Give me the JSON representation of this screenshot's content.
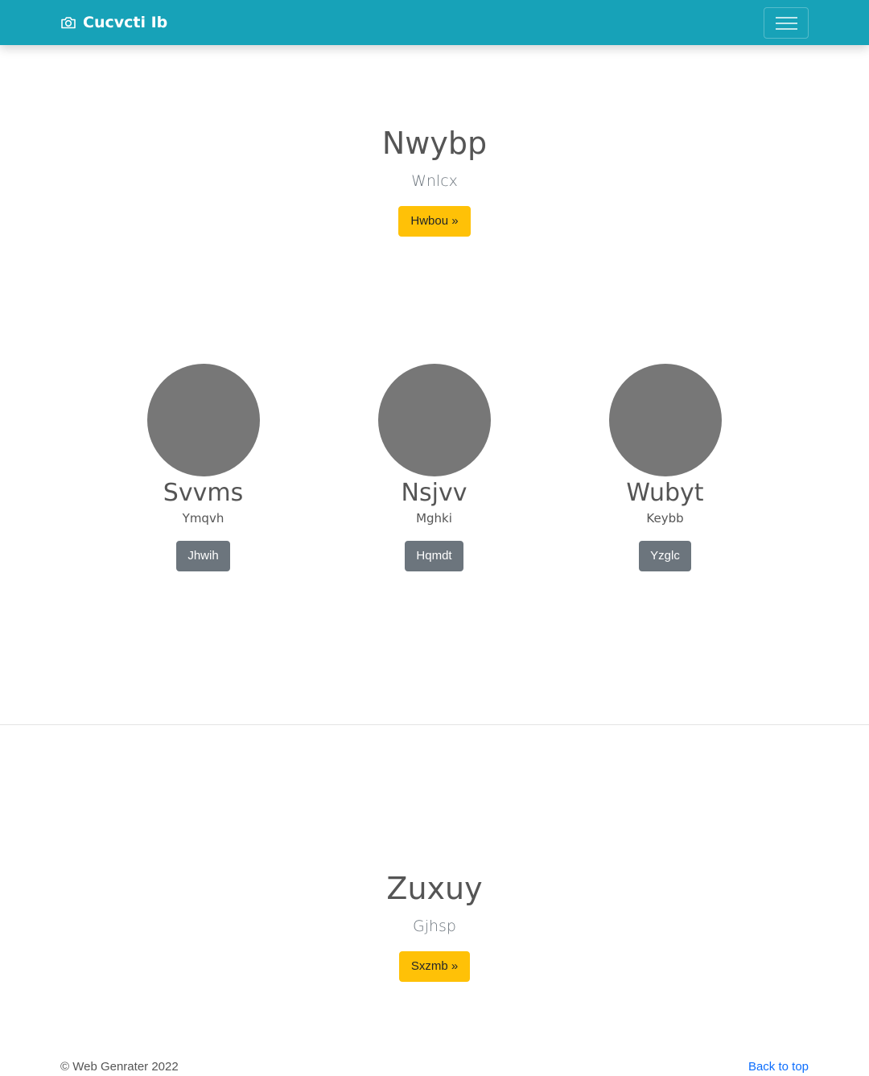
{
  "navbar": {
    "brand": "Cucvcti Ib",
    "brand_icon": "camera-icon",
    "toggler_icon": "hamburger-menu-icon",
    "background": "#17a2b8"
  },
  "hero1": {
    "title": "Nwybp",
    "subtitle": "Wnlcx",
    "button": "Hwbou »"
  },
  "features": [
    {
      "title": "Svvms",
      "subtitle": "Ymqvh",
      "button": "Jhwih"
    },
    {
      "title": "Nsjvv",
      "subtitle": "Mghki",
      "button": "Hqmdt"
    },
    {
      "title": "Wubyt",
      "subtitle": "Keybb",
      "button": "Yzglc"
    }
  ],
  "hero2": {
    "title": "Zuxuy",
    "subtitle": "Gjhsp",
    "button": "Sxzmb »"
  },
  "footer": {
    "copyright": "© Web Genrater 2022",
    "back_to_top": "Back to top"
  },
  "colors": {
    "warning": "#ffc107",
    "secondary": "#6c757d",
    "placeholder_circle": "#777777",
    "link": "#0d6efd"
  }
}
